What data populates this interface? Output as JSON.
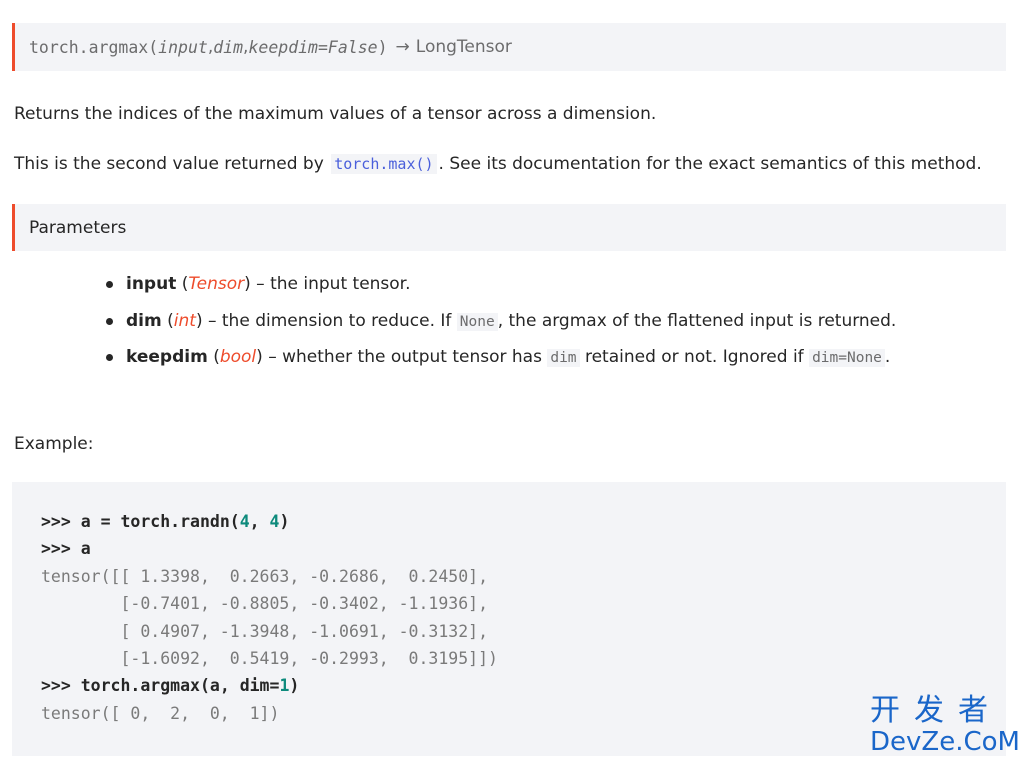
{
  "signature": {
    "name": "torch.argmax",
    "open": "(",
    "arg1": "input",
    "sep1": ", ",
    "arg2": "dim",
    "sep2": ", ",
    "arg3": "keepdim=False",
    "close": ")",
    "arrow": "→",
    "returns": "LongTensor"
  },
  "description": {
    "line1": "Returns the indices of the maximum values of a tensor across a dimension.",
    "line2_pre": "This is the second value returned by",
    "line2_link": "torch.max()",
    "line2_post": ". See its documentation for the exact semantics of this method."
  },
  "parameters": {
    "heading": "Parameters",
    "items": [
      {
        "name": "input",
        "open": " (",
        "type": "Tensor",
        "close": ")",
        "desc": " – the input tensor."
      },
      {
        "name": "dim",
        "open": " (",
        "type": "int",
        "close": ")",
        "desc_pre": " – the dimension to reduce. If ",
        "code": "None",
        "desc_post": ", the argmax of the flattened input is returned."
      },
      {
        "name": "keepdim",
        "open": " (",
        "type": "bool",
        "close": ")",
        "desc_pre": " – whether the output tensor has ",
        "code": "dim",
        "desc_mid": " retained or not. Ignored if ",
        "code2": "dim=None",
        "desc_post": "."
      }
    ]
  },
  "example": {
    "label": "Example:",
    "lines": [
      {
        "prompt": ">>> ",
        "code": "a = torch.randn(",
        "n1": "4",
        "mid": ", ",
        "n2": "4",
        "end": ")"
      },
      {
        "prompt": ">>> ",
        "code": "a"
      },
      {
        "out": "tensor([[ 1.3398,  0.2663, -0.2686,  0.2450],"
      },
      {
        "out": "        [-0.7401, -0.8805, -0.3402, -1.1936],"
      },
      {
        "out": "        [ 0.4907, -1.3948, -1.0691, -0.3132],"
      },
      {
        "out": "        [-1.6092,  0.5419, -0.2993,  0.3195]])"
      },
      {
        "prompt": ">>> ",
        "code": "torch.argmax(a, dim=",
        "n1": "1",
        "end": ")"
      },
      {
        "out": "tensor([ 0,  2,  0,  1])"
      }
    ]
  },
  "watermark": {
    "cn": "开发者",
    "en": "DevZe.CoM"
  }
}
